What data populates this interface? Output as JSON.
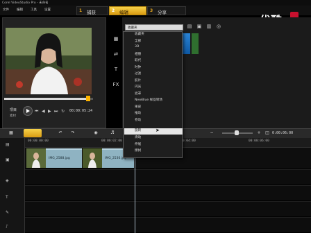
{
  "window": {
    "title": "Corel VideoStudio Pro - 未命名"
  },
  "menu": [
    "文件",
    "编辑",
    "工具",
    "设置"
  ],
  "steps": [
    {
      "num": "1",
      "label": "捕获",
      "active": false
    },
    {
      "num": "2",
      "label": "编辑",
      "active": true
    },
    {
      "num": "3",
      "label": "分享",
      "active": false
    }
  ],
  "watermark": {
    "text": "优酷"
  },
  "player": {
    "project_label": "项目",
    "clip_label": "素材",
    "timecode": "00:00:05:24"
  },
  "tools": [
    "FX"
  ],
  "gallery": {
    "selected": "收藏夹",
    "items": [
      "收藏夹",
      "全部",
      "3D",
      "相册",
      "取代",
      "时钟",
      "过滤",
      "胶片",
      "闪光",
      "遮罩",
      "NewBlue 样品转场",
      "果皮",
      "推动",
      "卷动",
      "旋转",
      "滑动",
      "伸展",
      "擦拭"
    ],
    "highlighted_index": 14
  },
  "timeline": {
    "time": "0:00:06:00",
    "ruler": [
      "00:00:00:00",
      "00:00:02:00",
      "00:00:04:00",
      "00:00:06:00"
    ],
    "clips": [
      "IMG_2588.jpg",
      "IMG_2536.jpg"
    ]
  }
}
